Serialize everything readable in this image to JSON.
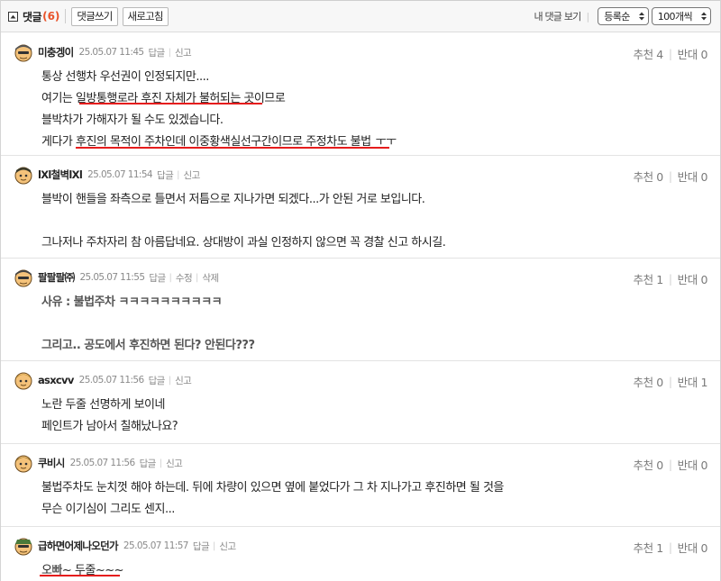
{
  "toolbar": {
    "title": "댓글",
    "count": "(6)",
    "write_label": "댓글쓰기",
    "refresh_label": "새로고침",
    "my_comments_label": "내 댓글 보기",
    "sort_value": "등록순",
    "perpage_value": "100개씩"
  },
  "comments": [
    {
      "nick": "미충겡이",
      "date": "25.05.07 11:45",
      "meta": [
        "답글",
        "신고"
      ],
      "up": "추천 4",
      "down": "반대 0",
      "lines": [
        "통상 선행차 우선권이 인정되지만....",
        "여기는 일방통행로라 후진 자체가 불허되는 곳이므로",
        "블박차가 가해자가 될 수도 있겠습니다.",
        "게다가 후진의 목적이 주차인데 이중황색실선구간이므로 주정차도 불법",
        "ㅜㅜ"
      ]
    },
    {
      "nick": "lXl철벽lXl",
      "date": "25.05.07 11:54",
      "meta": [
        "답글",
        "신고"
      ],
      "up": "추천 0",
      "down": "반대 0",
      "lines": [
        "블박이 핸들을 좌측으로 틀면서 저틈으로 지나가면 되겠다...가 안된 거로 보입니다.",
        "그나저나 주차자리 참 아름답네요. 상대방이 과실 인정하지 않으면 꼭 경찰 신고 하시길."
      ]
    },
    {
      "nick": "팔팔팔㈜",
      "date": "25.05.07 11:55",
      "meta": [
        "답글",
        "수정",
        "삭제"
      ],
      "up": "추천 1",
      "down": "반대 0",
      "lines": [
        "사유 : 불법주차 ㅋㅋㅋㅋㅋㅋㅋㅋㅋㅋ",
        "그리고.. 공도에서 후진하면 된다? 안된다???"
      ]
    },
    {
      "nick": "asxcvv",
      "date": "25.05.07 11:56",
      "meta": [
        "답글",
        "신고"
      ],
      "up": "추천 0",
      "down": "반대 1",
      "lines": [
        "노란 두줄 선명하게 보이네",
        "페인트가 남아서 칠해났나요?"
      ]
    },
    {
      "nick": "쿠비시",
      "date": "25.05.07 11:56",
      "meta": [
        "답글",
        "신고"
      ],
      "up": "추천 0",
      "down": "반대 0",
      "lines": [
        "불법주차도 눈치껏 해야 하는데. 뒤에 차량이 있으면 옆에 붙었다가 그 차 지나가고 후진하면 될 것을",
        "무슨 이기심이 그리도 센지..."
      ]
    },
    {
      "nick": "급하면어제나오던가",
      "date": "25.05.07 11:57",
      "meta": [
        "답글",
        "신고"
      ],
      "up": "추천 1",
      "down": "반대 0",
      "lines": [
        "오빠~ 두줄~~~"
      ]
    }
  ],
  "icons": {
    "toggle": "collapse-square-icon",
    "avatar": "level-avatar-icon",
    "select": "updown-arrow-icon"
  },
  "colors": {
    "accent": "#e8532a",
    "underline": "#e51c1c"
  }
}
